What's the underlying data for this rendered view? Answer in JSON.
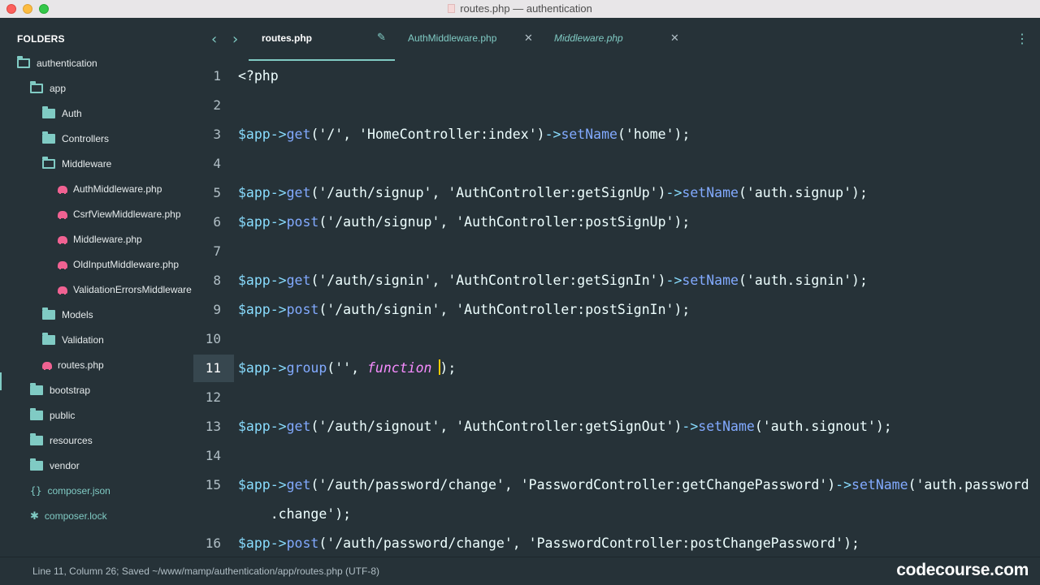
{
  "window": {
    "title": "routes.php — authentication"
  },
  "sidebar": {
    "header": "FOLDERS",
    "items": [
      {
        "label": "authentication",
        "type": "folder-open",
        "depth": 0
      },
      {
        "label": "app",
        "type": "folder-open",
        "depth": 1
      },
      {
        "label": "Auth",
        "type": "folder",
        "depth": 2
      },
      {
        "label": "Controllers",
        "type": "folder",
        "depth": 2
      },
      {
        "label": "Middleware",
        "type": "folder-open",
        "depth": 2
      },
      {
        "label": "AuthMiddleware.php",
        "type": "php-file",
        "depth": 3
      },
      {
        "label": "CsrfViewMiddleware.php",
        "type": "php-file",
        "depth": 3
      },
      {
        "label": "Middleware.php",
        "type": "php-file",
        "depth": 3
      },
      {
        "label": "OldInputMiddleware.php",
        "type": "php-file",
        "depth": 3
      },
      {
        "label": "ValidationErrorsMiddleware",
        "type": "php-file",
        "depth": 3
      },
      {
        "label": "Models",
        "type": "folder",
        "depth": 2
      },
      {
        "label": "Validation",
        "type": "folder",
        "depth": 2
      },
      {
        "label": "routes.php",
        "type": "php-file",
        "depth": 2
      },
      {
        "label": "bootstrap",
        "type": "folder",
        "depth": 1
      },
      {
        "label": "public",
        "type": "folder",
        "depth": 1
      },
      {
        "label": "resources",
        "type": "folder",
        "depth": 1
      },
      {
        "label": "vendor",
        "type": "folder",
        "depth": 1
      },
      {
        "label": "composer.json",
        "type": "json-file",
        "depth": 1
      },
      {
        "label": "composer.lock",
        "type": "lock-file",
        "depth": 1
      }
    ]
  },
  "tabs": [
    {
      "label": "routes.php",
      "state": "active-modified"
    },
    {
      "label": "AuthMiddleware.php",
      "state": "normal"
    },
    {
      "label": "Middleware.php",
      "state": "preview"
    }
  ],
  "editor": {
    "current_line": 11,
    "lines": [
      {
        "num": "1",
        "tokens": [
          {
            "t": "<?php",
            "c": "#eeffff"
          }
        ]
      },
      {
        "num": "2",
        "tokens": []
      },
      {
        "num": "3",
        "tokens": [
          {
            "t": "$app",
            "c": "#89ddff"
          },
          {
            "t": "->",
            "c": "#89ddff"
          },
          {
            "t": "get",
            "c": "#82aaff"
          },
          {
            "t": "('",
            "c": "#eeffff"
          },
          {
            "t": "/",
            "c": "#eeffff"
          },
          {
            "t": "', '",
            "c": "#eeffff"
          },
          {
            "t": "HomeController:index",
            "c": "#eeffff"
          },
          {
            "t": "')",
            "c": "#eeffff"
          },
          {
            "t": "->",
            "c": "#89ddff"
          },
          {
            "t": "setName",
            "c": "#82aaff"
          },
          {
            "t": "('home');",
            "c": "#eeffff"
          }
        ]
      },
      {
        "num": "4",
        "tokens": []
      },
      {
        "num": "5",
        "tokens": [
          {
            "t": "$app",
            "c": "#89ddff"
          },
          {
            "t": "->",
            "c": "#89ddff"
          },
          {
            "t": "get",
            "c": "#82aaff"
          },
          {
            "t": "('/auth/signup', 'AuthController:getSignUp')",
            "c": "#eeffff"
          },
          {
            "t": "->",
            "c": "#89ddff"
          },
          {
            "t": "setName",
            "c": "#82aaff"
          },
          {
            "t": "('auth.signup');",
            "c": "#eeffff"
          }
        ]
      },
      {
        "num": "6",
        "tokens": [
          {
            "t": "$app",
            "c": "#89ddff"
          },
          {
            "t": "->",
            "c": "#89ddff"
          },
          {
            "t": "post",
            "c": "#82aaff"
          },
          {
            "t": "('/auth/signup', 'AuthController:postSignUp');",
            "c": "#eeffff"
          }
        ]
      },
      {
        "num": "7",
        "tokens": []
      },
      {
        "num": "8",
        "tokens": [
          {
            "t": "$app",
            "c": "#89ddff"
          },
          {
            "t": "->",
            "c": "#89ddff"
          },
          {
            "t": "get",
            "c": "#82aaff"
          },
          {
            "t": "('/auth/signin', 'AuthController:getSignIn')",
            "c": "#eeffff"
          },
          {
            "t": "->",
            "c": "#89ddff"
          },
          {
            "t": "setName",
            "c": "#82aaff"
          },
          {
            "t": "('auth.signin');",
            "c": "#eeffff"
          }
        ]
      },
      {
        "num": "9",
        "tokens": [
          {
            "t": "$app",
            "c": "#89ddff"
          },
          {
            "t": "->",
            "c": "#89ddff"
          },
          {
            "t": "post",
            "c": "#82aaff"
          },
          {
            "t": "('/auth/signin', 'AuthController:postSignIn');",
            "c": "#eeffff"
          }
        ]
      },
      {
        "num": "10",
        "tokens": []
      },
      {
        "num": "11",
        "tokens": [
          {
            "t": "$app",
            "c": "#89ddff"
          },
          {
            "t": "->",
            "c": "#89ddff"
          },
          {
            "t": "group",
            "c": "#82aaff"
          },
          {
            "t": "('', ",
            "c": "#eeffff"
          },
          {
            "t": "function",
            "c": "#f78cff",
            "i": true
          },
          {
            "t": " ",
            "c": "#eeffff"
          },
          {
            "cursor": true
          },
          {
            "t": ");",
            "c": "#eeffff"
          }
        ]
      },
      {
        "num": "12",
        "tokens": []
      },
      {
        "num": "13",
        "tokens": [
          {
            "t": "$app",
            "c": "#89ddff"
          },
          {
            "t": "->",
            "c": "#89ddff"
          },
          {
            "t": "get",
            "c": "#82aaff"
          },
          {
            "t": "('/auth/signout', 'AuthController:getSignOut')",
            "c": "#eeffff"
          },
          {
            "t": "->",
            "c": "#89ddff"
          },
          {
            "t": "setName",
            "c": "#82aaff"
          },
          {
            "t": "('auth.signout');",
            "c": "#eeffff"
          }
        ]
      },
      {
        "num": "14",
        "tokens": []
      },
      {
        "num": "15",
        "tokens": [
          {
            "t": "$app",
            "c": "#89ddff"
          },
          {
            "t": "->",
            "c": "#89ddff"
          },
          {
            "t": "get",
            "c": "#82aaff"
          },
          {
            "t": "('/auth/password/change', 'PasswordController:getChangePassword')",
            "c": "#eeffff"
          },
          {
            "t": "->",
            "c": "#89ddff"
          },
          {
            "t": "setName",
            "c": "#82aaff"
          },
          {
            "t": "('auth.password",
            "c": "#eeffff"
          }
        ]
      },
      {
        "num": "",
        "tokens": [
          {
            "t": "    .change');",
            "c": "#eeffff"
          }
        ]
      },
      {
        "num": "16",
        "tokens": [
          {
            "t": "$app",
            "c": "#89ddff"
          },
          {
            "t": "->",
            "c": "#89ddff"
          },
          {
            "t": "post",
            "c": "#82aaff"
          },
          {
            "t": "('/auth/password/change', 'PasswordController:postChangePassword');",
            "c": "#eeffff"
          }
        ]
      }
    ]
  },
  "statusbar": {
    "text": "Line 11, Column 26; Saved ~/www/mamp/authentication/app/routes.php (UTF-8)"
  },
  "watermark": "codecourse.com",
  "colors": {
    "background": "#263238",
    "accent": "#80cbc4",
    "php_icon": "#f06292",
    "cursor": "#ffcc00"
  }
}
